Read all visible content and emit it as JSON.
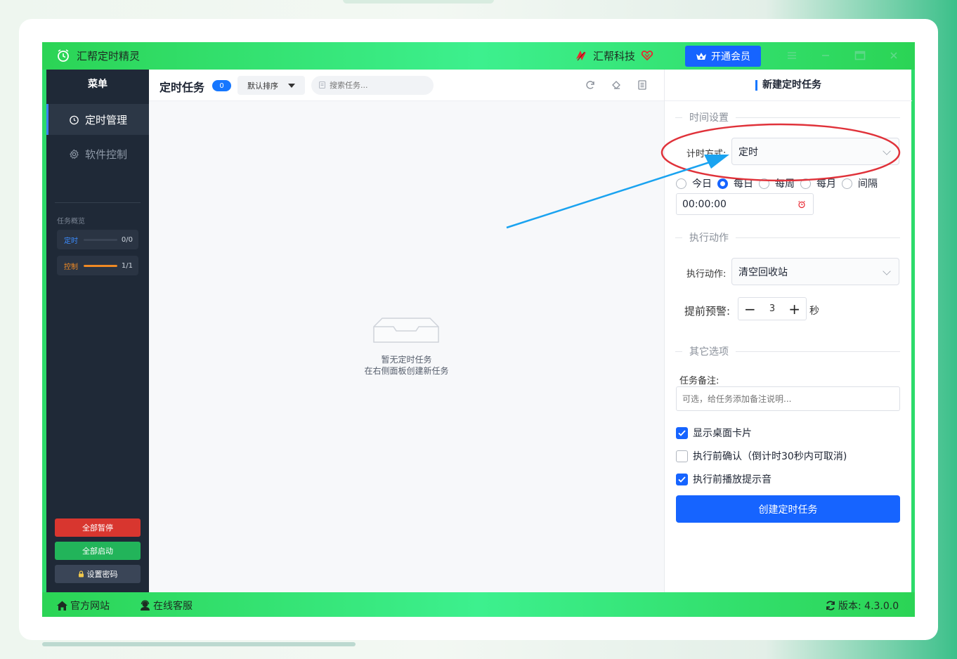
{
  "titlebar": {
    "app_title": "汇帮定时精灵",
    "brand": "汇帮科技",
    "vip_label": "开通会员"
  },
  "sidebar": {
    "header": "菜单",
    "items": [
      {
        "label": "定时管理",
        "icon": "clock-icon",
        "active": true
      },
      {
        "label": "软件控制",
        "icon": "gear-icon",
        "active": false
      }
    ],
    "overview_label": "任务概览",
    "stats": [
      {
        "label": "定时",
        "count": "0/0",
        "fill": 0,
        "color": "#3b8cff"
      },
      {
        "label": "控制",
        "count": "1/1",
        "fill": 1,
        "color": "#f08a24"
      }
    ],
    "buttons": {
      "pause_all": "全部暂停",
      "start_all": "全部启动",
      "set_password": "设置密码"
    }
  },
  "center": {
    "title": "定时任务",
    "badge": "0",
    "sort_label": "默认排序",
    "search_placeholder": "搜索任务...",
    "empty_line1": "暂无定时任务",
    "empty_line2": "在右侧面板创建新任务"
  },
  "right": {
    "title": "新建定时任务",
    "time_section": "时间设置",
    "timing_mode_label": "计时方式:",
    "timing_mode_value": "定时",
    "radios": [
      {
        "label": "今日",
        "checked": false
      },
      {
        "label": "每日",
        "checked": true
      },
      {
        "label": "每周",
        "checked": false
      },
      {
        "label": "每月",
        "checked": false
      },
      {
        "label": "间隔",
        "checked": false
      }
    ],
    "time_value": "00:00:00",
    "action_section": "执行动作",
    "action_label": "执行动作:",
    "action_value": "清空回收站",
    "warn_label": "提前预警:",
    "warn_value": "3",
    "warn_unit": "秒",
    "other_section": "其它选项",
    "note_label": "任务备注:",
    "note_placeholder": "可选，给任务添加备注说明...",
    "checks": [
      {
        "label": "显示桌面卡片",
        "checked": true
      },
      {
        "label": "执行前确认（倒计时30秒内可取消)",
        "checked": false
      },
      {
        "label": "执行前播放提示音",
        "checked": true
      }
    ],
    "create_button": "创建定时任务"
  },
  "statusbar": {
    "website": "官方网站",
    "support": "在线客服",
    "version": "版本: 4.3.0.0"
  },
  "colors": {
    "accent": "#1664ff",
    "titlebar_green": "#2bd455",
    "annotation_red": "#e0323a",
    "annotation_arrow": "#1aa3f0"
  }
}
